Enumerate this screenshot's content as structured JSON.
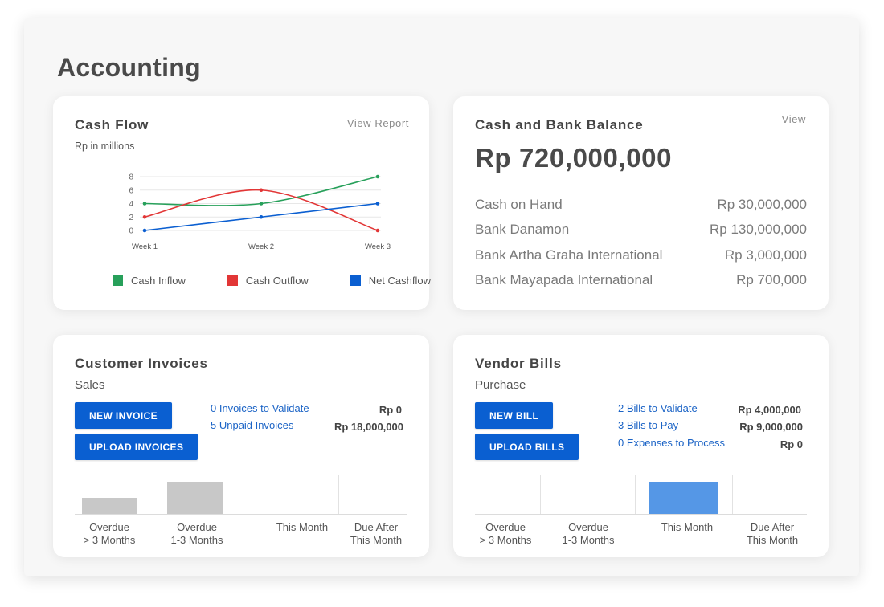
{
  "page": {
    "title": "Accounting"
  },
  "cash_flow": {
    "title": "Cash Flow",
    "subtitle": "Rp in millions",
    "view_link": "View Report",
    "legend": [
      {
        "label": "Cash Inflow",
        "color": "#27a05a"
      },
      {
        "label": "Cash Outflow",
        "color": "#e23636"
      },
      {
        "label": "Net Cashflow",
        "color": "#0b5fd1"
      }
    ]
  },
  "chart_data": {
    "type": "line",
    "x": [
      "Week 1",
      "Week 2",
      "Week 3"
    ],
    "series": [
      {
        "name": "Cash Inflow",
        "color": "#27a05a",
        "values": [
          4,
          4,
          8
        ]
      },
      {
        "name": "Cash Outflow",
        "color": "#e23636",
        "values": [
          2,
          6,
          0
        ]
      },
      {
        "name": "Net Cashflow",
        "color": "#0b5fd1",
        "values": [
          0,
          2,
          4
        ]
      }
    ],
    "y_ticks": [
      0,
      2,
      4,
      6,
      8
    ],
    "ylim": [
      0,
      8
    ],
    "grid": true,
    "legend": "bottom"
  },
  "cash_bank": {
    "title": "Cash and Bank Balance",
    "view_link": "View",
    "total": "Rp 720,000,000",
    "accounts": [
      {
        "name": "Cash on Hand",
        "amount": "Rp 30,000,000"
      },
      {
        "name": "Bank Danamon",
        "amount": "Rp 130,000,000"
      },
      {
        "name": "Bank Artha Graha International",
        "amount": "Rp 3,000,000"
      },
      {
        "name": "Bank Mayapada International",
        "amount": "Rp 700,000"
      }
    ]
  },
  "customer_invoices": {
    "title": "Customer Invoices",
    "subtitle": "Sales",
    "new_button": "NEW INVOICE",
    "upload_button": "UPLOAD INVOICES",
    "links": [
      {
        "label": "0 Invoices to Validate",
        "value": "Rp 0"
      },
      {
        "label": "5 Unpaid Invoices",
        "value": "Rp 18,000,000"
      }
    ],
    "aging": [
      {
        "label": "Overdue\n> 3 Months",
        "level": 0.5
      },
      {
        "label": "Overdue\n1-3 Months",
        "level": 1.0
      },
      {
        "label": "This Month",
        "level": 0
      },
      {
        "label": "Due After\nThis Month",
        "level": 0
      }
    ],
    "bar_color": "#c8c8c8"
  },
  "vendor_bills": {
    "title": "Vendor Bills",
    "subtitle": "Purchase",
    "new_button": "NEW BILL",
    "upload_button": "UPLOAD BILLS",
    "links": [
      {
        "label": "2 Bills to Validate",
        "value": "Rp 4,000,000"
      },
      {
        "label": "3 Bills to Pay",
        "value": "Rp 9,000,000"
      },
      {
        "label": "0 Expenses to Process",
        "value": "Rp 0"
      }
    ],
    "aging": [
      {
        "label": "Overdue\n> 3 Months",
        "level": 0
      },
      {
        "label": "Overdue\n1-3 Months",
        "level": 0
      },
      {
        "label": "This Month",
        "level": 1.0
      },
      {
        "label": "Due After\nThis Month",
        "level": 0
      }
    ],
    "bar_color": "#5597e6"
  }
}
